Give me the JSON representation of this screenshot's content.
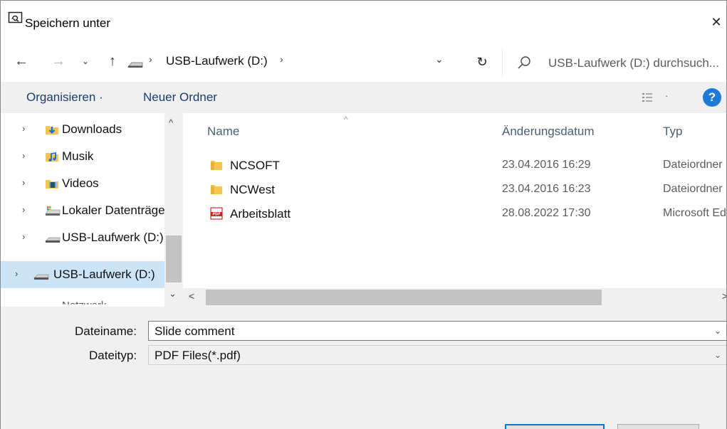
{
  "window": {
    "title": "Speichern unter",
    "close_glyph": "✕"
  },
  "nav": {
    "back_glyph": "←",
    "forward_glyph": "→",
    "recent_glyph": "⌄",
    "up_glyph": "↑",
    "address_sep": "›",
    "address": "USB-Laufwerk (D:)",
    "address_dropdown_glyph": "⌄",
    "refresh_glyph": "↻",
    "search_placeholder": "USB-Laufwerk (D:) durchsuch..."
  },
  "toolbar": {
    "organize": "Organisieren ·",
    "new_folder": "Neuer Ordner",
    "view_dropdown_glyph": "·",
    "help": "?"
  },
  "sidebar": {
    "chevron": "›",
    "scroll_up": "^",
    "scroll_down": "⌄",
    "items": [
      {
        "label": "Downloads",
        "icon": "downloads-folder-icon"
      },
      {
        "label": "Musik",
        "icon": "music-folder-icon"
      },
      {
        "label": "Videos",
        "icon": "videos-folder-icon"
      },
      {
        "label": "Lokaler Datenträger",
        "icon": "local-disk-icon"
      },
      {
        "label": "USB-Laufwerk (D:)",
        "icon": "usb-drive-icon"
      },
      {
        "label": "USB-Laufwerk (D:)",
        "icon": "usb-drive-icon",
        "selected": true
      }
    ],
    "peek_label": "Netzwerk"
  },
  "filelist": {
    "sort_arrow": "^",
    "columns": {
      "name": "Name",
      "date": "Änderungsdatum",
      "type": "Typ"
    },
    "rows": [
      {
        "name": "NCSOFT",
        "date": "23.04.2016 16:29",
        "type": "Dateiordner",
        "icon": "folder-icon"
      },
      {
        "name": "NCWest",
        "date": "23.04.2016 16:23",
        "type": "Dateiordner",
        "icon": "folder-icon"
      },
      {
        "name": "Arbeitsblatt",
        "date": "28.08.2022 17:30",
        "type": "Microsoft Edge PDF Document",
        "icon": "pdf-icon"
      }
    ],
    "scroll_left": "<",
    "scroll_right": ">"
  },
  "form": {
    "filename_label": "Dateiname:",
    "filename_value": "Slide comment",
    "filetype_label": "Dateityp:",
    "filetype_value": "PDF Files(*.pdf)",
    "dropdown_glyph": "⌄"
  },
  "colors": {
    "accent": "#0078d4",
    "selection": "#cce4f7",
    "toolbar_bg": "#f0f0f0",
    "help": "#1e7ad6"
  }
}
